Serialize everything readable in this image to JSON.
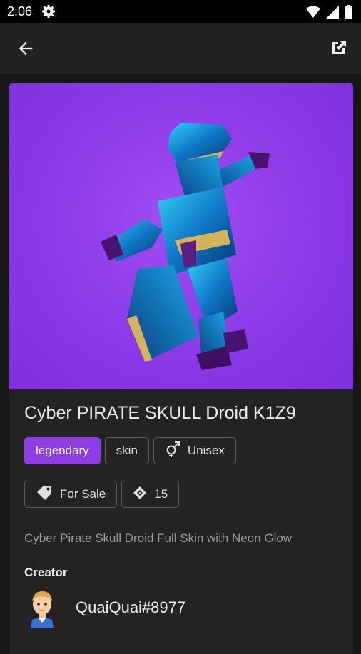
{
  "status_bar": {
    "time": "2:06",
    "icons": [
      "settings-icon",
      "wifi-icon",
      "signal-icon",
      "battery-icon"
    ]
  },
  "app_bar": {
    "icons": [
      "back-arrow-icon",
      "open-external-icon"
    ]
  },
  "item": {
    "title": "Cyber PIRATE SKULL Droid K1Z9",
    "tags": [
      {
        "label": "legendary",
        "color": "#8e3ce6"
      },
      {
        "label": "skin"
      },
      {
        "label": "Unisex",
        "icon": "gender-icon"
      }
    ],
    "status_chips": [
      {
        "label": "For Sale",
        "icon": "price-tag-icon"
      },
      {
        "label": "15",
        "icon": "diamond-currency-icon"
      }
    ],
    "description": "Cyber Pirate Skull Droid Full Skin with Neon Glow",
    "creator": {
      "heading": "Creator",
      "name": "QuaiQuai#8977"
    },
    "image_background": "#8f3ce9"
  }
}
